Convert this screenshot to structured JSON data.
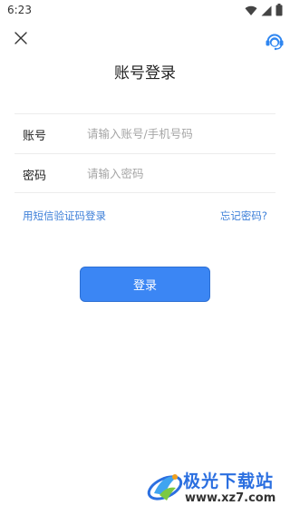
{
  "status_bar": {
    "time": "6:23",
    "icons": [
      "wifi-icon",
      "signal-icon",
      "battery-icon"
    ]
  },
  "header": {
    "close_icon": "close-icon",
    "service_icon": "customer-service-icon",
    "title": "账号登录"
  },
  "form": {
    "account": {
      "label": "账号",
      "placeholder": "请输入账号/手机号码",
      "value": ""
    },
    "password": {
      "label": "密码",
      "placeholder": "请输入密码",
      "value": ""
    }
  },
  "links": {
    "sms_login": "用短信验证码登录",
    "forgot_password": "忘记密码?"
  },
  "actions": {
    "login_label": "登录"
  },
  "watermark": {
    "name": "极光下载站",
    "url": "www.xz7.com"
  },
  "colors": {
    "accent": "#3b86f4",
    "link": "#3d7fd8",
    "divider": "#ececec"
  }
}
